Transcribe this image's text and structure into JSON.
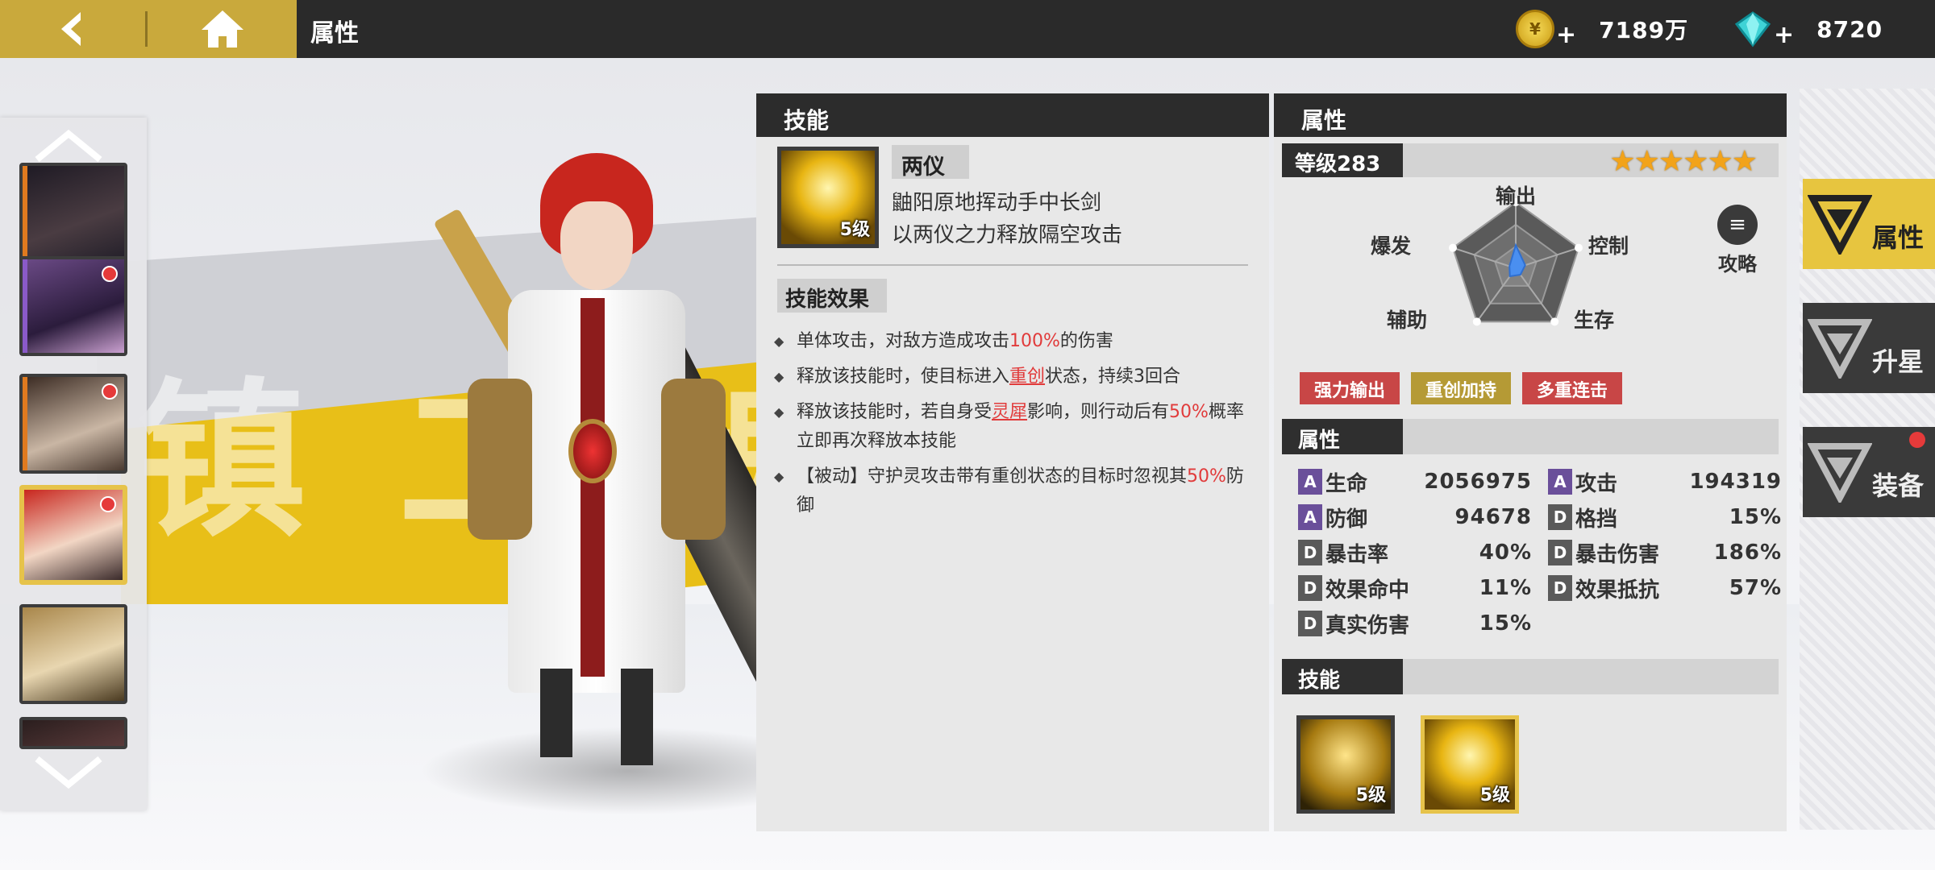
{
  "topbar": {
    "title": "属性",
    "gold": {
      "icon": "gold-coin-icon",
      "value": "7189万",
      "plus": "+"
    },
    "gems": {
      "icon": "diamond-icon",
      "value": "8720",
      "plus": "+"
    }
  },
  "scene": {
    "banner_text": "镇 二 魂 预"
  },
  "hero_list": {
    "heroes": [
      {
        "id": "hero-1",
        "selected": false,
        "red_dot": false
      },
      {
        "id": "hero-2",
        "selected": false,
        "red_dot": true
      },
      {
        "id": "hero-3",
        "selected": false,
        "red_dot": true
      },
      {
        "id": "hero-4",
        "selected": true,
        "red_dot": true
      },
      {
        "id": "hero-5",
        "selected": false,
        "red_dot": false
      },
      {
        "id": "hero-6",
        "selected": false,
        "red_dot": false
      }
    ]
  },
  "skill_panel": {
    "header": "技能",
    "skill_name": "两仪",
    "skill_level": "5级",
    "desc_line1": "鼬阳原地挥动手中长剑",
    "desc_line2": "以两仪之力释放隔空攻击",
    "effects_title": "技能效果",
    "effects": [
      {
        "a": "单体攻击，对敌方造成攻击",
        "hl": "100%",
        "b": "的伤害"
      },
      {
        "a": "释放该技能时，使目标进入",
        "hl": "重创",
        "b": "状态，持续3回合"
      },
      {
        "a": "释放该技能时，若自身受",
        "hl": "灵犀",
        "b": "影响，则行动后有",
        "hl2": "50%",
        "c": "概率立即再次释放本技能"
      },
      {
        "a": "【被动】守护灵攻击带有重创状态的目标时忽视其",
        "hl": "50%",
        "b": "防御"
      }
    ]
  },
  "attr_panel": {
    "header": "属性",
    "level": "等级283",
    "stars": "★★★★★★",
    "radar": {
      "labels": {
        "top": "输出",
        "right": "控制",
        "left": "爆发",
        "bottom_left": "辅助",
        "bottom_right": "生存"
      },
      "values": {
        "output": 0.35,
        "control": 0.15,
        "survive": 0.12,
        "support": 0.15,
        "burst": 0.1
      }
    },
    "guide_label": "攻略",
    "tags": [
      {
        "text": "强力输出",
        "color": "red"
      },
      {
        "text": "重创加持",
        "color": "gold"
      },
      {
        "text": "多重连击",
        "color": "red"
      }
    ],
    "stats_title": "属性",
    "stats": [
      {
        "grade": "A",
        "name": "生命",
        "value": "2056975"
      },
      {
        "grade": "A",
        "name": "攻击",
        "value": "194319"
      },
      {
        "grade": "A",
        "name": "防御",
        "value": "94678"
      },
      {
        "grade": "D",
        "name": "格挡",
        "value": "15%"
      },
      {
        "grade": "D",
        "name": "暴击率",
        "value": "40%"
      },
      {
        "grade": "D",
        "name": "暴击伤害",
        "value": "186%"
      },
      {
        "grade": "D",
        "name": "效果命中",
        "value": "11%"
      },
      {
        "grade": "D",
        "name": "效果抵抗",
        "value": "57%"
      },
      {
        "grade": "D",
        "name": "真实伤害",
        "value": "15%"
      }
    ],
    "skills_title": "技能",
    "skill_slots": [
      {
        "level": "5级"
      },
      {
        "level": "5级"
      }
    ]
  },
  "side_tabs": [
    {
      "label": "属性",
      "icon": "attribute-tab-icon",
      "active": true,
      "dot": false
    },
    {
      "label": "升星",
      "icon": "star-up-tab-icon",
      "active": false,
      "dot": false
    },
    {
      "label": "装备",
      "icon": "equipment-tab-icon",
      "active": false,
      "dot": true
    }
  ],
  "colors": {
    "accent_gold": "#c9a93c",
    "tab_active": "#e7c53f",
    "highlight_red": "#e13b3b",
    "grade_A": "#6a4f9a"
  }
}
